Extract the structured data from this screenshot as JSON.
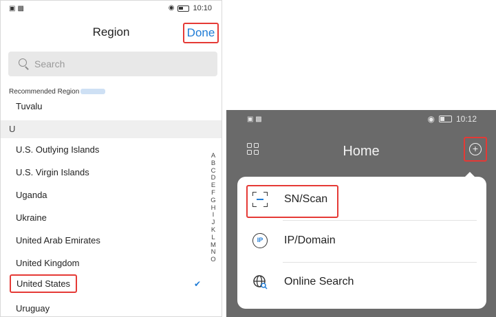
{
  "left_screen": {
    "status_bar": {
      "signal": "²⁴ₐₗₗ",
      "time": "10:10"
    },
    "header": {
      "title": "Region",
      "done_label": "Done"
    },
    "search": {
      "placeholder": "Search"
    },
    "recommended": {
      "label": "Recommended Region",
      "item": "Tuvalu"
    },
    "section_letter": "U",
    "countries": [
      "U.S. Outlying Islands",
      "U.S. Virgin Islands",
      "Uganda",
      "Ukraine",
      "United Arab Emirates",
      "United Kingdom",
      "United States",
      "Uruguay"
    ],
    "selected_country": "United States",
    "alphabet_index": [
      "A",
      "B",
      "C",
      "D",
      "E",
      "F",
      "G",
      "H",
      "I",
      "J",
      "K",
      "L",
      "M",
      "N",
      "O"
    ]
  },
  "right_screen": {
    "status_bar": {
      "time": "10:12"
    },
    "header": {
      "title": "Home"
    },
    "menu": {
      "items": [
        {
          "label": "SN/Scan",
          "icon": "scan-icon"
        },
        {
          "label": "IP/Domain",
          "icon": "ip-icon"
        },
        {
          "label": "Online Search",
          "icon": "globe-search-icon"
        }
      ]
    },
    "highlight_color": "#e53935",
    "accent_color": "#1e7bd6"
  }
}
